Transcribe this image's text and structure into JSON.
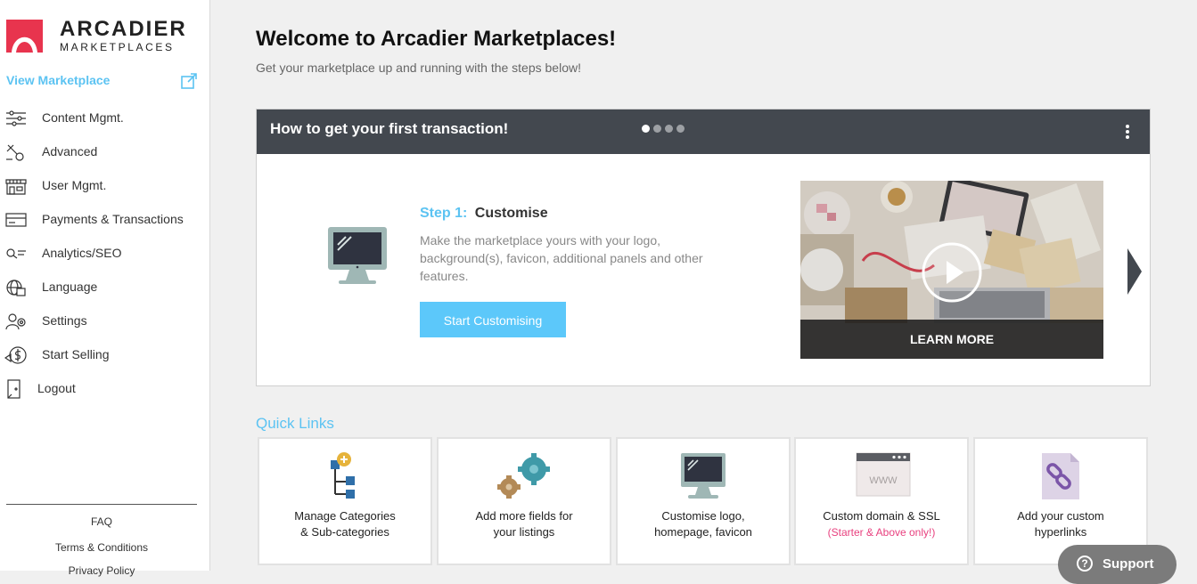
{
  "brand": {
    "name": "ARCADIER",
    "sub": "MARKETPLACES",
    "accent": "#5cc3f2",
    "logo_red": "#e8344e"
  },
  "sidebar": {
    "view_marketplace": "View Marketplace",
    "items": [
      {
        "label": "Content Mgmt.",
        "icon": "sliders-icon"
      },
      {
        "label": "Advanced",
        "icon": "advanced-tools-icon"
      },
      {
        "label": "User Mgmt.",
        "icon": "storefront-icon"
      },
      {
        "label": "Payments & Transactions",
        "icon": "credit-card-icon"
      },
      {
        "label": "Analytics/SEO",
        "icon": "search-analytics-icon"
      },
      {
        "label": "Language",
        "icon": "globe-icon"
      },
      {
        "label": "Settings",
        "icon": "settings-users-icon"
      },
      {
        "label": "Start Selling",
        "icon": "dollar-icon"
      },
      {
        "label": "Logout",
        "icon": "logout-icon"
      }
    ],
    "footer": {
      "faq": "FAQ",
      "terms": "Terms & Conditions",
      "privacy": "Privacy Policy"
    }
  },
  "main": {
    "title": "Welcome to Arcadier Marketplaces!",
    "subtitle": "Get your marketplace up and running with the steps below!",
    "card": {
      "title": "How to get your first transaction!",
      "dots_total": 4,
      "active_dot": 1,
      "step_number": "Step 1:",
      "step_name": "Customise",
      "step_description": "Make the marketplace yours with your logo, background(s), favicon, additional panels and other features.",
      "button": "Start Customising",
      "video_label": "LEARN MORE"
    },
    "quick_links": {
      "title": "Quick Links",
      "items": [
        {
          "line1": "Manage Categories",
          "line2": "& Sub-categories",
          "note": "",
          "icon": "category-tree-icon"
        },
        {
          "line1": "Add more fields for",
          "line2": "your listings",
          "note": "",
          "icon": "gears-icon"
        },
        {
          "line1": "Customise logo,",
          "line2": "homepage, favicon",
          "note": "",
          "icon": "monitor-icon"
        },
        {
          "line1": "Custom domain & SSL",
          "line2": "",
          "note": "(Starter & Above only!)",
          "icon": "browser-www-icon"
        },
        {
          "line1": "Add your custom",
          "line2": "hyperlinks",
          "note": "",
          "icon": "link-file-icon"
        }
      ]
    }
  },
  "support": {
    "label": "Support"
  }
}
